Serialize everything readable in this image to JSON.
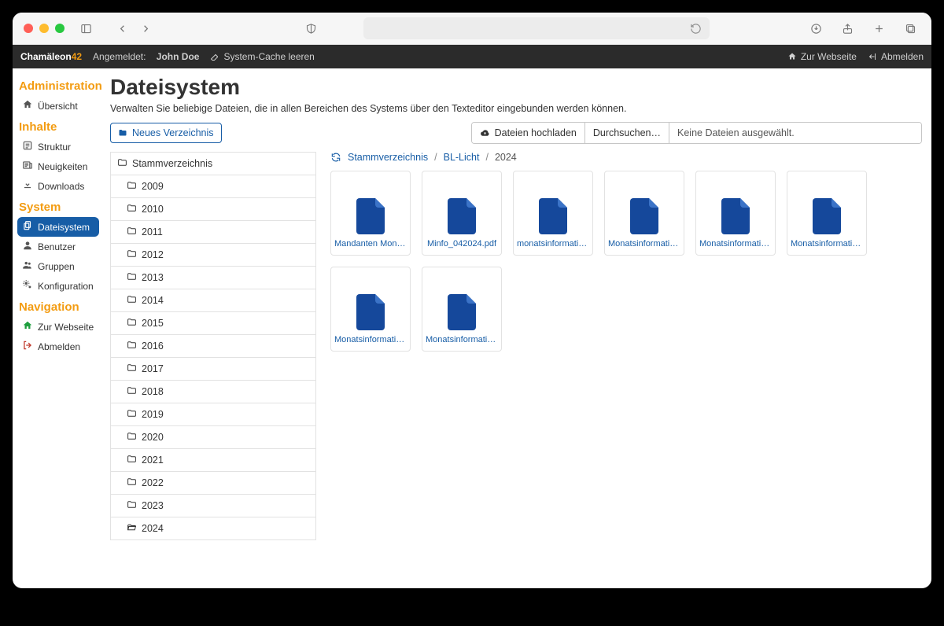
{
  "browser": {
    "url_placeholder": ""
  },
  "topbar": {
    "brand_main": "Chamäleon",
    "brand_suffix": "42",
    "logged_in_label": "Angemeldet:",
    "user_name": "John Doe",
    "cache_label": "System-Cache leeren",
    "to_site": "Zur Webseite",
    "logout": "Abmelden"
  },
  "sidebar": {
    "sections": [
      {
        "title": "Administration",
        "items": [
          {
            "icon": "home",
            "label": "Übersicht"
          }
        ]
      },
      {
        "title": "Inhalte",
        "items": [
          {
            "icon": "list",
            "label": "Struktur"
          },
          {
            "icon": "news",
            "label": "Neuigkeiten"
          },
          {
            "icon": "download",
            "label": "Downloads"
          }
        ]
      },
      {
        "title": "System",
        "items": [
          {
            "icon": "files",
            "label": "Dateisystem",
            "active": true
          },
          {
            "icon": "user",
            "label": "Benutzer"
          },
          {
            "icon": "users",
            "label": "Gruppen"
          },
          {
            "icon": "cogs",
            "label": "Konfiguration"
          }
        ]
      },
      {
        "title": "Navigation",
        "items": [
          {
            "icon": "home-green",
            "label": "Zur Webseite"
          },
          {
            "icon": "logout-red",
            "label": "Abmelden"
          }
        ]
      }
    ]
  },
  "page": {
    "title": "Dateisystem",
    "subtitle": "Verwalten Sie beliebige Dateien, die in allen Bereichen des Systems über den Texteditor eingebunden werden können.",
    "new_dir_btn": "Neues Verzeichnis",
    "upload_btn": "Dateien hochladen",
    "browse_btn": "Durchsuchen…",
    "no_file": "Keine Dateien ausgewählt."
  },
  "tree": {
    "root": "Stammverzeichnis",
    "years": [
      "2009",
      "2010",
      "2011",
      "2012",
      "2013",
      "2014",
      "2015",
      "2016",
      "2017",
      "2018",
      "2019",
      "2020",
      "2021",
      "2022",
      "2023"
    ],
    "open": "2024"
  },
  "breadcrumb": {
    "root": "Stammverzeichnis",
    "mid": "BL-Licht",
    "leaf": "2024"
  },
  "files": [
    {
      "name": "Mandanten Monat…"
    },
    {
      "name": "Minfo_042024.pdf"
    },
    {
      "name": "monatsinformation…"
    },
    {
      "name": "Monatsinformation…"
    },
    {
      "name": "Monatsinformation…"
    },
    {
      "name": "Monatsinformation…"
    },
    {
      "name": "Monatsinformation…"
    },
    {
      "name": "Monatsinformation…"
    }
  ]
}
